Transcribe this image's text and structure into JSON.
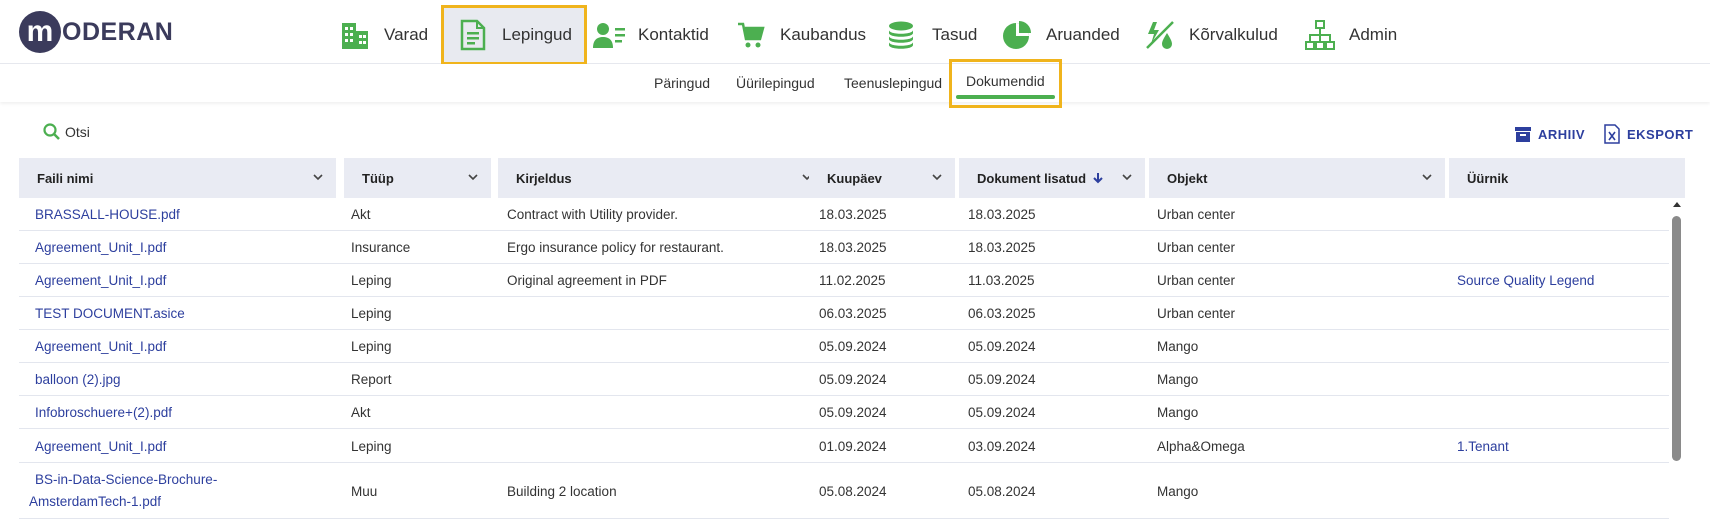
{
  "app": {
    "logo_letter": "m",
    "logo_text": "ODERAN"
  },
  "nav": [
    {
      "label": "Varad",
      "icon": "building-icon"
    },
    {
      "label": "Lepingud",
      "icon": "document-icon",
      "active": true
    },
    {
      "label": "Kontaktid",
      "icon": "contacts-icon"
    },
    {
      "label": "Kaubandus",
      "icon": "cart-icon"
    },
    {
      "label": "Tasud",
      "icon": "coins-icon"
    },
    {
      "label": "Aruanded",
      "icon": "pie-chart-icon"
    },
    {
      "label": "Kõrvalkulud",
      "icon": "utility-icon"
    },
    {
      "label": "Admin",
      "icon": "org-chart-icon"
    }
  ],
  "subnav": [
    {
      "label": "Päringud"
    },
    {
      "label": "Üürilepingud"
    },
    {
      "label": "Teenuslepingud"
    },
    {
      "label": "Dokumendid",
      "active": true
    }
  ],
  "toolbar": {
    "search_label": "Otsi",
    "archive_label": "ARHIIV",
    "export_label": "EKSPORT"
  },
  "colors": {
    "accent": "#4caf50",
    "highlight": "#f0b41c",
    "link": "#2d3f9e",
    "logo": "#3b3b5c",
    "header_bg": "#e9ebf3"
  },
  "table": {
    "columns": [
      {
        "label": "Faili nimi"
      },
      {
        "label": "Tüüp"
      },
      {
        "label": "Kirjeldus"
      },
      {
        "label": "Kuupäev"
      },
      {
        "label": "Dokument lisatud",
        "sorted": "desc"
      },
      {
        "label": "Objekt"
      },
      {
        "label": "Üürnik"
      }
    ],
    "rows": [
      {
        "file": "BRASSALL-HOUSE.pdf",
        "type": "Akt",
        "desc": "Contract with Utility provider.",
        "date": "18.03.2025",
        "added": "18.03.2025",
        "object": "Urban center",
        "tenant": ""
      },
      {
        "file": "Agreement_Unit_I.pdf",
        "type": "Insurance",
        "desc": "Ergo insurance policy for restaurant.",
        "date": "18.03.2025",
        "added": "18.03.2025",
        "object": "Urban center",
        "tenant": ""
      },
      {
        "file": "Agreement_Unit_I.pdf",
        "type": "Leping",
        "desc": "Original agreement in PDF",
        "date": "11.02.2025",
        "added": "11.03.2025",
        "object": "Urban center",
        "tenant": "Source Quality Legend"
      },
      {
        "file": "TEST DOCUMENT.asice",
        "type": "Leping",
        "desc": "",
        "date": "06.03.2025",
        "added": "06.03.2025",
        "object": "Urban center",
        "tenant": ""
      },
      {
        "file": "Agreement_Unit_I.pdf",
        "type": "Leping",
        "desc": "",
        "date": "05.09.2024",
        "added": "05.09.2024",
        "object": "Mango",
        "tenant": ""
      },
      {
        "file": "balloon (2).jpg",
        "type": "Report",
        "desc": "",
        "date": "05.09.2024",
        "added": "05.09.2024",
        "object": "Mango",
        "tenant": ""
      },
      {
        "file": "Infobroschuere+(2).pdf",
        "type": "Akt",
        "desc": "",
        "date": "05.09.2024",
        "added": "05.09.2024",
        "object": "Mango",
        "tenant": ""
      },
      {
        "file": "Agreement_Unit_I.pdf",
        "type": "Leping",
        "desc": "",
        "date": "01.09.2024",
        "added": "03.09.2024",
        "object": "Alpha&Omega",
        "tenant": "1.Tenant"
      },
      {
        "file": "BS-in-Data-Science-Brochure-",
        "file2": "AmsterdamTech-1.pdf",
        "type": "Muu",
        "desc": "Building 2 location",
        "date": "05.08.2024",
        "added": "05.08.2024",
        "object": "Mango",
        "tenant": ""
      }
    ]
  }
}
